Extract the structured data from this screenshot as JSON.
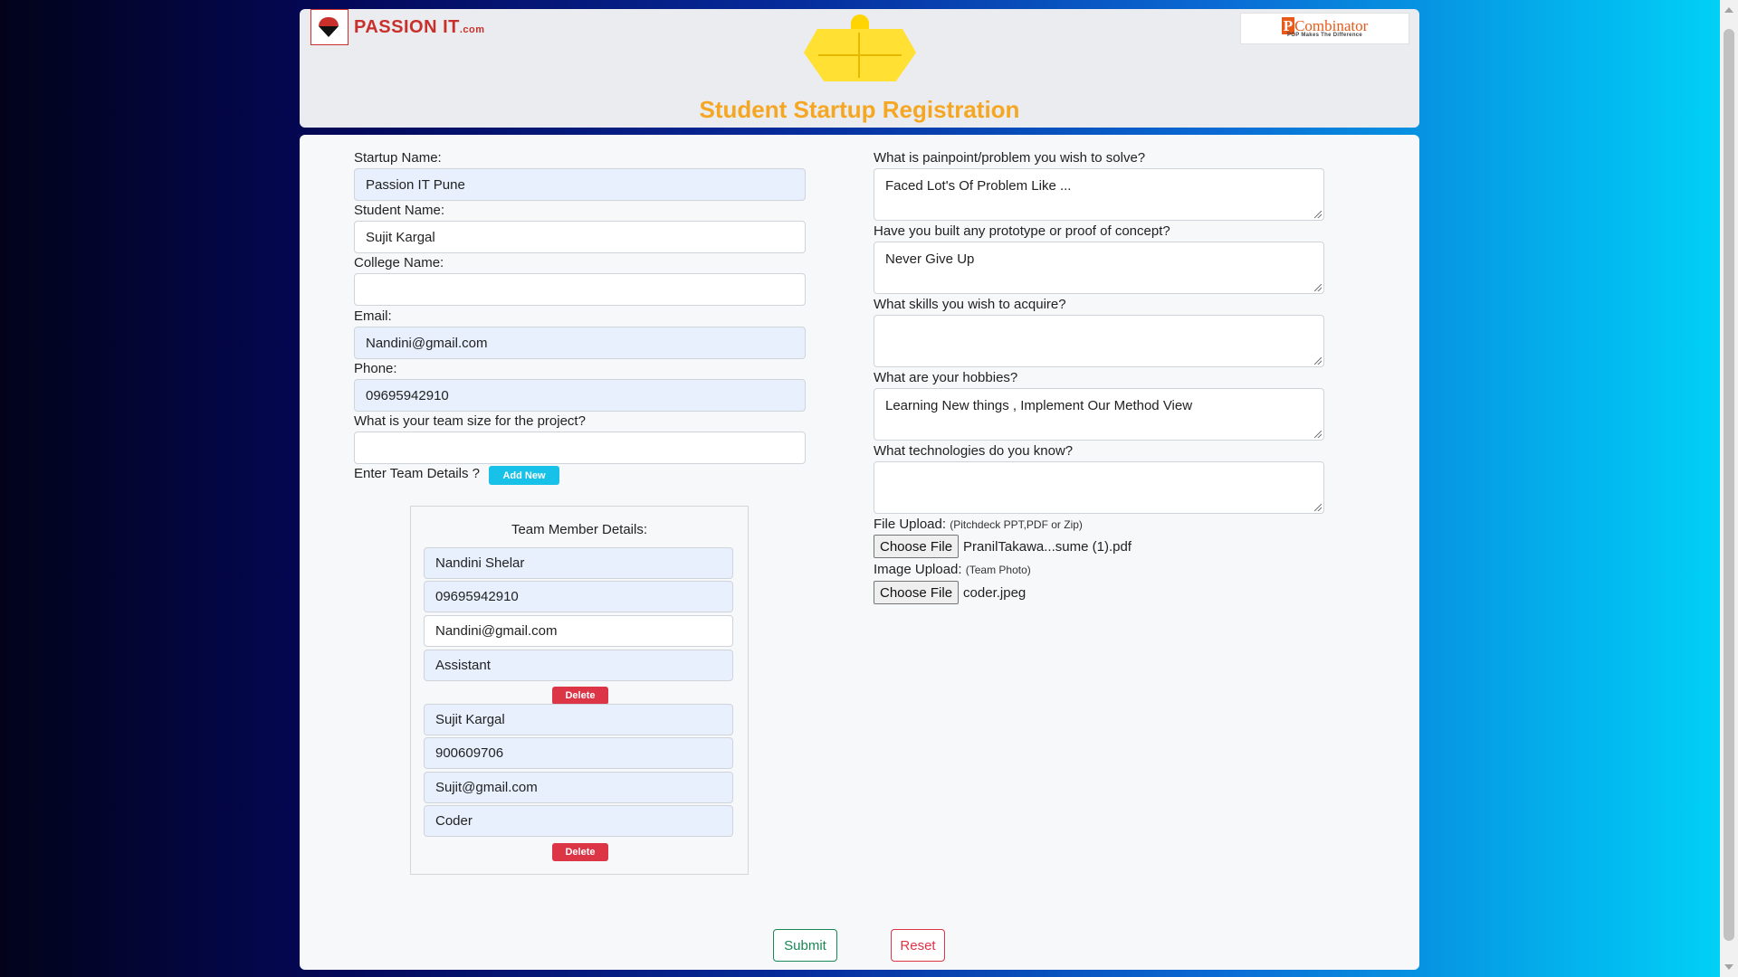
{
  "header": {
    "brand_left": "PASSION IT",
    "brand_left_suffix": ".com",
    "brand_right": "Combinator",
    "brand_right_letter": "P",
    "brand_right_tagline": "POP Makes The Difference",
    "title": "Student Startup Registration"
  },
  "form": {
    "startup_name": {
      "label": "Startup Name:",
      "value": "Passion IT Pune"
    },
    "student_name": {
      "label": "Student Name:",
      "value": "Sujit Kargal"
    },
    "college_name": {
      "label": "College Name:",
      "value": ""
    },
    "email": {
      "label": "Email:",
      "value": "Nandini@gmail.com"
    },
    "phone": {
      "label": "Phone:",
      "value": "09695942910"
    },
    "team_size": {
      "label": "What is your team size for the project?",
      "value": ""
    },
    "team_details": {
      "label": "Enter Team Details ?",
      "add_button": "Add New"
    },
    "painpoint": {
      "label": "What is painpoint/problem you wish to solve?",
      "value": "Faced Lot's Of Problem Like ..."
    },
    "prototype": {
      "label": "Have you built any prototype or proof of concept?",
      "value": "Never Give Up"
    },
    "skills": {
      "label": "What skills you wish to acquire?",
      "value": ""
    },
    "hobbies": {
      "label": "What are your hobbies?",
      "value": "Learning New things , Implement Our Method View"
    },
    "technologies": {
      "label": "What technologies do you know?",
      "value": ""
    },
    "file_upload": {
      "label": "File Upload:",
      "note": "(Pitchdeck PPT,PDF or Zip)",
      "button": "Choose File",
      "filename": "PranilTakawa...sume (1).pdf"
    },
    "image_upload": {
      "label": "Image Upload:",
      "note": "(Team Photo)",
      "button": "Choose File",
      "filename": "coder.jpeg"
    },
    "submit": "Submit",
    "reset": "Reset"
  },
  "team": {
    "title": "Team Member Details:",
    "delete_label": "Delete",
    "members": [
      {
        "name": "Nandini Shelar",
        "phone": "09695942910",
        "email": "Nandini@gmail.com",
        "role": "Assistant"
      },
      {
        "name": "Sujit Kargal",
        "phone": "900609706",
        "email": "Sujit@gmail.com",
        "role": "Coder"
      }
    ]
  },
  "colors": {
    "accent_title": "#f5a623",
    "add_button": "#17c1e8",
    "delete_button": "#dc3545",
    "submit": "#198754",
    "reset": "#dc3545",
    "autofill_bg": "#e8f0fe"
  }
}
